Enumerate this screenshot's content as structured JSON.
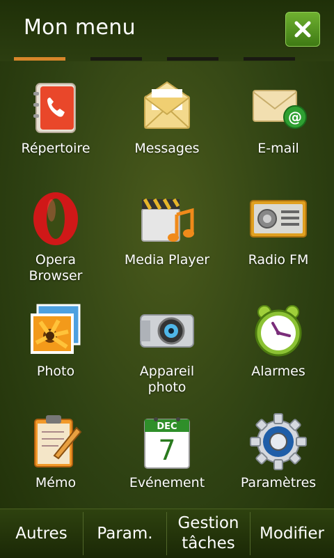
{
  "header": {
    "title": "Mon menu",
    "close_icon": "close-icon"
  },
  "pager": {
    "pages": 4,
    "active_index": 0
  },
  "apps": [
    {
      "label": "Répertoire",
      "icon": "phonebook-icon"
    },
    {
      "label": "Messages",
      "icon": "envelope-icon"
    },
    {
      "label": "E-mail",
      "icon": "email-icon"
    },
    {
      "label": "Opera\nBrowser",
      "icon": "opera-icon"
    },
    {
      "label": "Media Player",
      "icon": "media-player-icon"
    },
    {
      "label": "Radio FM",
      "icon": "radio-icon"
    },
    {
      "label": "Photo",
      "icon": "photo-icon"
    },
    {
      "label": "Appareil\nphoto",
      "icon": "camera-icon"
    },
    {
      "label": "Alarmes",
      "icon": "alarm-clock-icon"
    },
    {
      "label": "Mémo",
      "icon": "memo-icon"
    },
    {
      "label": "Evénement",
      "icon": "calendar-icon",
      "calendar_month": "DEC",
      "calendar_day": "7"
    },
    {
      "label": "Paramètres",
      "icon": "gear-icon"
    }
  ],
  "footer": {
    "buttons": [
      {
        "label": "Autres"
      },
      {
        "label": "Param."
      },
      {
        "label": "Gestion\ntâches"
      },
      {
        "label": "Modifier"
      }
    ]
  },
  "colors": {
    "accent": "#d7862a",
    "close_green": "#4f9420"
  }
}
